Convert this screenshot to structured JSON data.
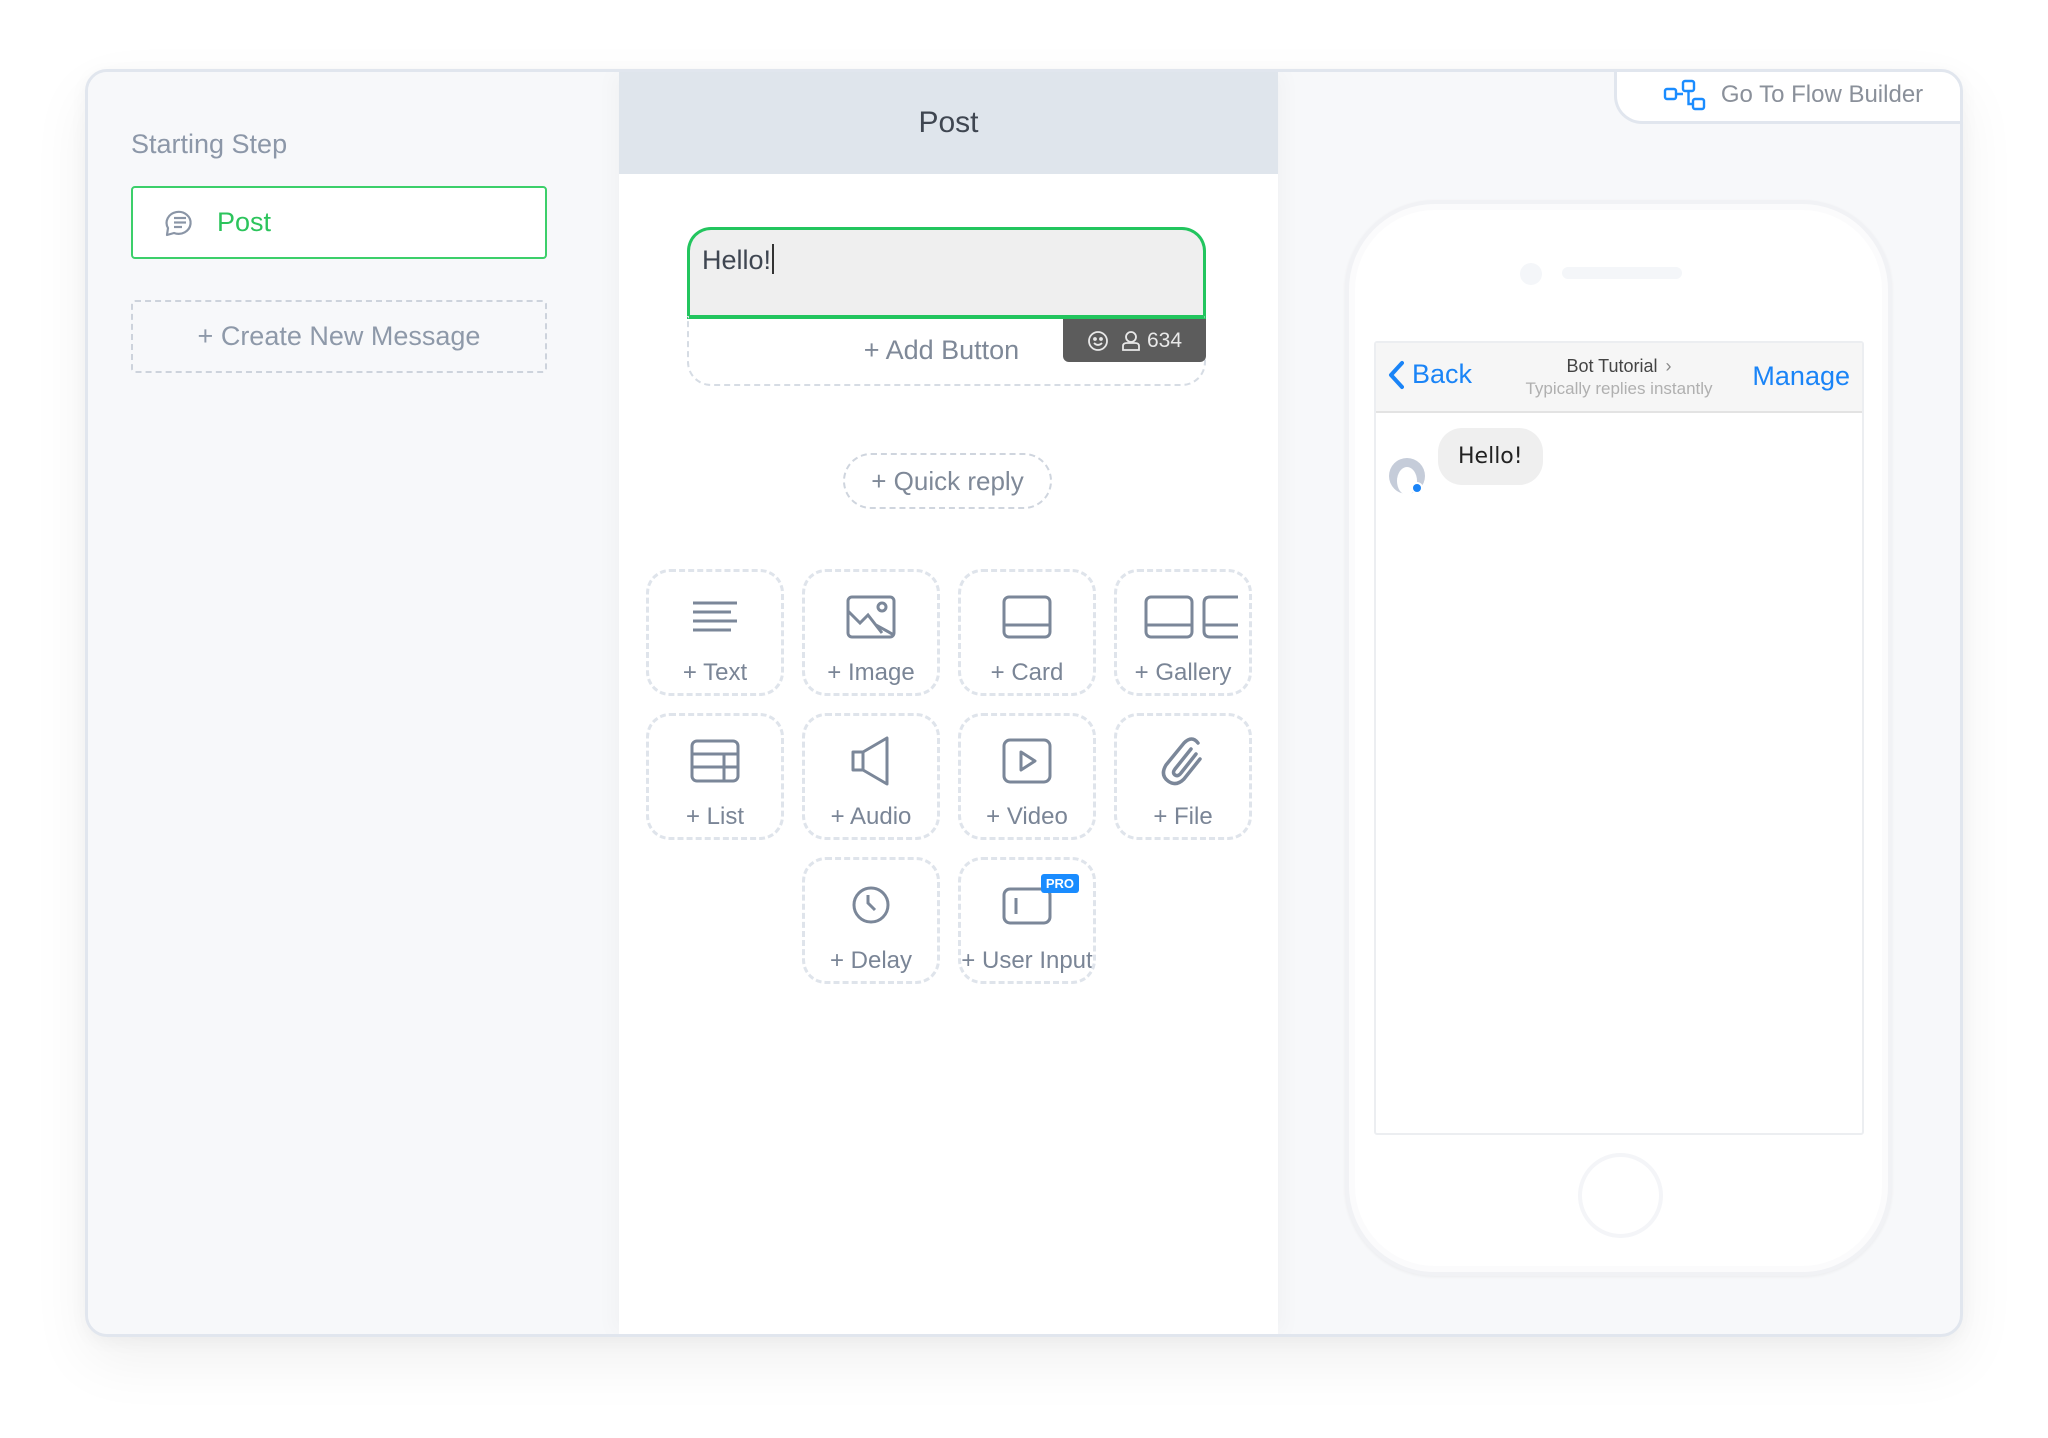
{
  "sidebar": {
    "section_title": "Starting Step",
    "steps": [
      {
        "label": "Post",
        "icon": "message-bubble-icon",
        "active": true
      }
    ],
    "create_new_label": "+ Create New Message"
  },
  "editor": {
    "title": "Post",
    "message_text": "Hello!",
    "add_button_label": "+ Add Button",
    "toolbar": {
      "emoji_icon": "smiley-icon",
      "user_icon": "user-icon",
      "count": "634"
    },
    "quick_reply_label": "+ Quick reply",
    "content_types": [
      {
        "label": "+ Text",
        "icon": "text-lines-icon"
      },
      {
        "label": "+ Image",
        "icon": "image-icon"
      },
      {
        "label": "+ Card",
        "icon": "card-icon"
      },
      {
        "label": "+ Gallery",
        "icon": "gallery-icon"
      },
      {
        "label": "+ List",
        "icon": "list-table-icon"
      },
      {
        "label": "+ Audio",
        "icon": "speaker-icon"
      },
      {
        "label": "+ Video",
        "icon": "video-play-icon"
      },
      {
        "label": "+ File",
        "icon": "paperclip-icon"
      },
      {
        "label": "+ Delay",
        "icon": "clock-icon"
      },
      {
        "label": "+ User Input",
        "icon": "input-field-icon",
        "badge": "PRO"
      }
    ]
  },
  "preview": {
    "flow_builder_label": "Go To Flow Builder",
    "chat": {
      "back_label": "Back",
      "bot_name": "Bot Tutorial",
      "subtitle": "Typically replies instantly",
      "manage_label": "Manage",
      "messages": [
        {
          "from": "bot",
          "text": "Hello!"
        }
      ]
    }
  },
  "colors": {
    "accent_green": "#22c55e",
    "link_blue": "#1a84f7",
    "pro_badge": "#1a8cff",
    "header_bg": "#dfe5ec"
  }
}
